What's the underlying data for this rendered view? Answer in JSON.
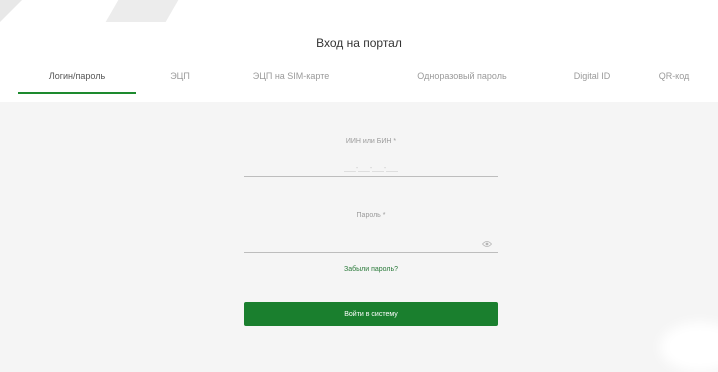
{
  "page": {
    "title": "Вход на портал"
  },
  "tabs": [
    {
      "label": "Логин/пароль",
      "active": true
    },
    {
      "label": "ЭЦП",
      "active": false
    },
    {
      "label": "ЭЦП на SIM-карте",
      "active": false
    },
    {
      "label": "Одноразовый пароль",
      "active": false
    },
    {
      "label": "Digital ID",
      "active": false
    },
    {
      "label": "QR-код",
      "active": false
    }
  ],
  "form": {
    "login_label": "ИИН или БИН *",
    "login_placeholder": "___-___-___-___",
    "password_label": "Пароль *",
    "forgot_password": "Забыли пароль?",
    "submit_label": "Войти в систему"
  },
  "colors": {
    "accent": "#1a7f2e",
    "tab_underline": "#1d8a2e",
    "background": "#f5f5f5"
  }
}
